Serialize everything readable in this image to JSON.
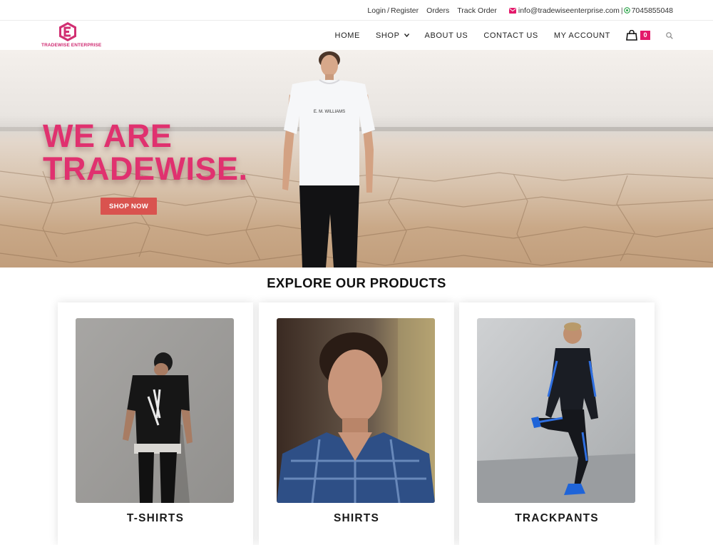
{
  "topbar": {
    "login": "Login",
    "register": "Register",
    "separator": "/",
    "orders": "Orders",
    "track_order": "Track Order",
    "email": "info@tradewiseenterprise.com",
    "divider": "|",
    "phone": "7045855048"
  },
  "logo": {
    "name": "TRADEWISE ENTERPRISE",
    "color": "#cf2b72"
  },
  "nav": {
    "items": [
      {
        "label": "HOME"
      },
      {
        "label": "SHOP"
      },
      {
        "label": "ABOUT US"
      },
      {
        "label": "CONTACT US"
      },
      {
        "label": "MY ACCOUNT"
      }
    ],
    "cart_count": "0",
    "accent": "#e3196a"
  },
  "hero": {
    "line1": "WE ARE",
    "line2": "TRADEWISE.",
    "shop_now": "SHOP NOW",
    "tshirt_text": "E. M. WILLIAMS"
  },
  "products": {
    "title": "ΕXPLORΕ OUR PRODUCTS",
    "items": [
      {
        "label": "T-SHIRTS"
      },
      {
        "label": "SHIRTS"
      },
      {
        "label": "TRACKPANTS"
      }
    ]
  }
}
